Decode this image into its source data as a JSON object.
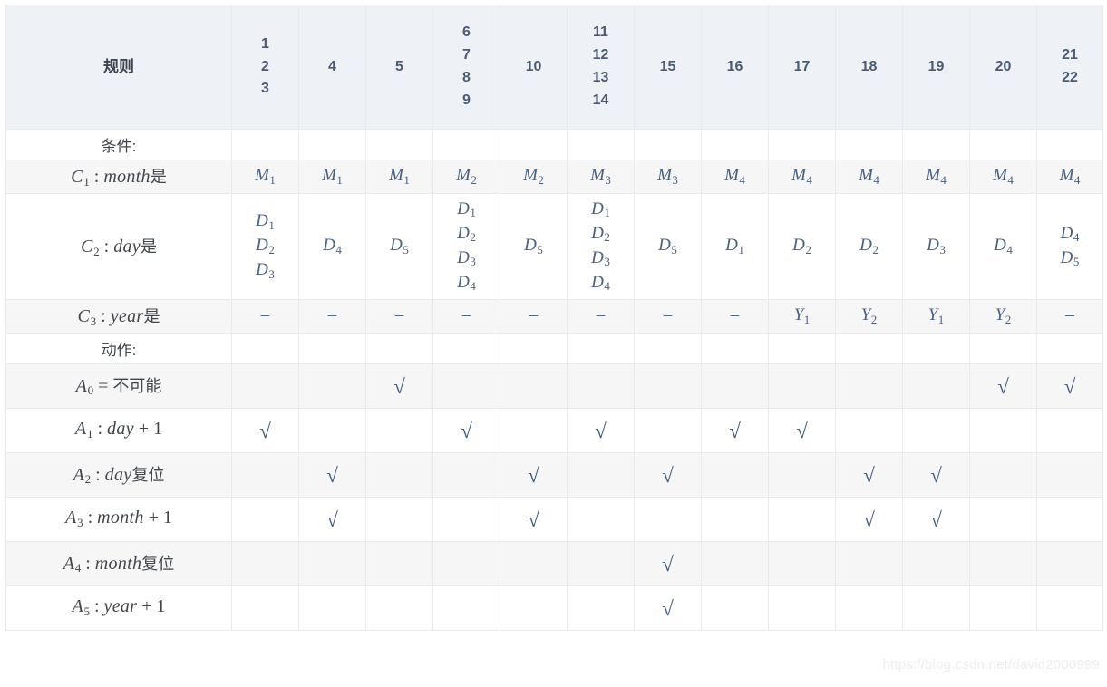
{
  "table": {
    "corner_header": "规则",
    "rule_columns": [
      {
        "lines": [
          "1",
          "2",
          "3"
        ]
      },
      {
        "lines": [
          "4"
        ]
      },
      {
        "lines": [
          "5"
        ]
      },
      {
        "lines": [
          "6",
          "7",
          "8",
          "9"
        ]
      },
      {
        "lines": [
          "10"
        ]
      },
      {
        "lines": [
          "11",
          "12",
          "13",
          "14"
        ]
      },
      {
        "lines": [
          "15"
        ]
      },
      {
        "lines": [
          "16"
        ]
      },
      {
        "lines": [
          "17"
        ]
      },
      {
        "lines": [
          "18"
        ]
      },
      {
        "lines": [
          "19"
        ]
      },
      {
        "lines": [
          "20"
        ]
      },
      {
        "lines": [
          "21",
          "22"
        ]
      }
    ],
    "rows": [
      {
        "kind": "section",
        "label_parts": [
          {
            "type": "plain",
            "text": "条件:"
          }
        ],
        "cells": [
          [],
          [],
          [],
          [],
          [],
          [],
          [],
          [],
          [],
          [],
          [],
          [],
          []
        ]
      },
      {
        "kind": "values",
        "label_parts": [
          {
            "type": "var",
            "text": "C",
            "sub": "1"
          },
          {
            "type": "math",
            "text": " : "
          },
          {
            "type": "var",
            "text": "month"
          },
          {
            "type": "cjk",
            "text": "是"
          }
        ],
        "cells": [
          [
            {
              "text": "M",
              "sub": "1"
            }
          ],
          [
            {
              "text": "M",
              "sub": "1"
            }
          ],
          [
            {
              "text": "M",
              "sub": "1"
            }
          ],
          [
            {
              "text": "M",
              "sub": "2"
            }
          ],
          [
            {
              "text": "M",
              "sub": "2"
            }
          ],
          [
            {
              "text": "M",
              "sub": "3"
            }
          ],
          [
            {
              "text": "M",
              "sub": "3"
            }
          ],
          [
            {
              "text": "M",
              "sub": "4"
            }
          ],
          [
            {
              "text": "M",
              "sub": "4"
            }
          ],
          [
            {
              "text": "M",
              "sub": "4"
            }
          ],
          [
            {
              "text": "M",
              "sub": "4"
            }
          ],
          [
            {
              "text": "M",
              "sub": "4"
            }
          ],
          [
            {
              "text": "M",
              "sub": "4"
            }
          ]
        ]
      },
      {
        "kind": "values",
        "label_parts": [
          {
            "type": "var",
            "text": "C",
            "sub": "2"
          },
          {
            "type": "math",
            "text": " : "
          },
          {
            "type": "var",
            "text": "day"
          },
          {
            "type": "cjk",
            "text": "是"
          }
        ],
        "cells": [
          [
            {
              "text": "D",
              "sub": "1"
            },
            {
              "text": "D",
              "sub": "2"
            },
            {
              "text": "D",
              "sub": "3"
            }
          ],
          [
            {
              "text": "D",
              "sub": "4"
            }
          ],
          [
            {
              "text": "D",
              "sub": "5"
            }
          ],
          [
            {
              "text": "D",
              "sub": "1"
            },
            {
              "text": "D",
              "sub": "2"
            },
            {
              "text": "D",
              "sub": "3"
            },
            {
              "text": "D",
              "sub": "4"
            }
          ],
          [
            {
              "text": "D",
              "sub": "5"
            }
          ],
          [
            {
              "text": "D",
              "sub": "1"
            },
            {
              "text": "D",
              "sub": "2"
            },
            {
              "text": "D",
              "sub": "3"
            },
            {
              "text": "D",
              "sub": "4"
            }
          ],
          [
            {
              "text": "D",
              "sub": "5"
            }
          ],
          [
            {
              "text": "D",
              "sub": "1"
            }
          ],
          [
            {
              "text": "D",
              "sub": "2"
            }
          ],
          [
            {
              "text": "D",
              "sub": "2"
            }
          ],
          [
            {
              "text": "D",
              "sub": "3"
            }
          ],
          [
            {
              "text": "D",
              "sub": "4"
            }
          ],
          [
            {
              "text": "D",
              "sub": "4"
            },
            {
              "text": "D",
              "sub": "5"
            }
          ]
        ]
      },
      {
        "kind": "values",
        "label_parts": [
          {
            "type": "var",
            "text": "C",
            "sub": "3"
          },
          {
            "type": "math",
            "text": " : "
          },
          {
            "type": "var",
            "text": "year"
          },
          {
            "type": "cjk",
            "text": "是"
          }
        ],
        "cells": [
          [
            {
              "text": "–",
              "dash": true
            }
          ],
          [
            {
              "text": "–",
              "dash": true
            }
          ],
          [
            {
              "text": "–",
              "dash": true
            }
          ],
          [
            {
              "text": "–",
              "dash": true
            }
          ],
          [
            {
              "text": "–",
              "dash": true
            }
          ],
          [
            {
              "text": "–",
              "dash": true
            }
          ],
          [
            {
              "text": "–",
              "dash": true
            }
          ],
          [
            {
              "text": "–",
              "dash": true
            }
          ],
          [
            {
              "text": "Y",
              "sub": "1"
            }
          ],
          [
            {
              "text": "Y",
              "sub": "2"
            }
          ],
          [
            {
              "text": "Y",
              "sub": "1"
            }
          ],
          [
            {
              "text": "Y",
              "sub": "2"
            }
          ],
          [
            {
              "text": "–",
              "dash": true
            }
          ]
        ]
      },
      {
        "kind": "section",
        "label_parts": [
          {
            "type": "plain",
            "text": "动作:"
          }
        ],
        "cells": [
          [],
          [],
          [],
          [],
          [],
          [],
          [],
          [],
          [],
          [],
          [],
          [],
          []
        ]
      },
      {
        "kind": "checks",
        "label_parts": [
          {
            "type": "var",
            "text": "A",
            "sub": "0"
          },
          {
            "type": "math",
            "text": " = "
          },
          {
            "type": "cjk",
            "text": "不可能"
          }
        ],
        "checks": [
          false,
          false,
          true,
          false,
          false,
          false,
          false,
          false,
          false,
          false,
          false,
          true,
          true
        ]
      },
      {
        "kind": "checks",
        "label_parts": [
          {
            "type": "var",
            "text": "A",
            "sub": "1"
          },
          {
            "type": "math",
            "text": " : "
          },
          {
            "type": "var",
            "text": "day"
          },
          {
            "type": "math",
            "text": " + 1"
          }
        ],
        "checks": [
          true,
          false,
          false,
          true,
          false,
          true,
          false,
          true,
          true,
          false,
          false,
          false,
          false
        ]
      },
      {
        "kind": "checks",
        "label_parts": [
          {
            "type": "var",
            "text": "A",
            "sub": "2"
          },
          {
            "type": "math",
            "text": " : "
          },
          {
            "type": "var",
            "text": "day"
          },
          {
            "type": "cjk",
            "text": "复位"
          }
        ],
        "checks": [
          false,
          true,
          false,
          false,
          true,
          false,
          true,
          false,
          false,
          true,
          true,
          false,
          false
        ]
      },
      {
        "kind": "checks",
        "label_parts": [
          {
            "type": "var",
            "text": "A",
            "sub": "3"
          },
          {
            "type": "math",
            "text": " : "
          },
          {
            "type": "var",
            "text": "month"
          },
          {
            "type": "math",
            "text": " + 1"
          }
        ],
        "checks": [
          false,
          true,
          false,
          false,
          true,
          false,
          false,
          false,
          false,
          true,
          true,
          false,
          false
        ]
      },
      {
        "kind": "checks",
        "label_parts": [
          {
            "type": "var",
            "text": "A",
            "sub": "4"
          },
          {
            "type": "math",
            "text": " : "
          },
          {
            "type": "var",
            "text": "month"
          },
          {
            "type": "cjk",
            "text": "复位"
          }
        ],
        "checks": [
          false,
          false,
          false,
          false,
          false,
          false,
          true,
          false,
          false,
          false,
          false,
          false,
          false
        ]
      },
      {
        "kind": "checks",
        "label_parts": [
          {
            "type": "var",
            "text": "A",
            "sub": "5"
          },
          {
            "type": "math",
            "text": " : "
          },
          {
            "type": "var",
            "text": "year"
          },
          {
            "type": "math",
            "text": " + 1"
          }
        ],
        "checks": [
          false,
          false,
          false,
          false,
          false,
          false,
          true,
          false,
          false,
          false,
          false,
          false,
          false
        ]
      }
    ],
    "check_glyph": "√"
  },
  "watermark": {
    "text": "https://blog.csdn.net/david2000999"
  },
  "colors": {
    "header_bg": "#eef2f6",
    "header_text": "#4a5b73",
    "zebra_bg": "#f6f6f7",
    "border": "#e8eaed",
    "value_text": "#4a6080",
    "check_text": "#3d5a80",
    "watermark_text": "#ededed"
  }
}
